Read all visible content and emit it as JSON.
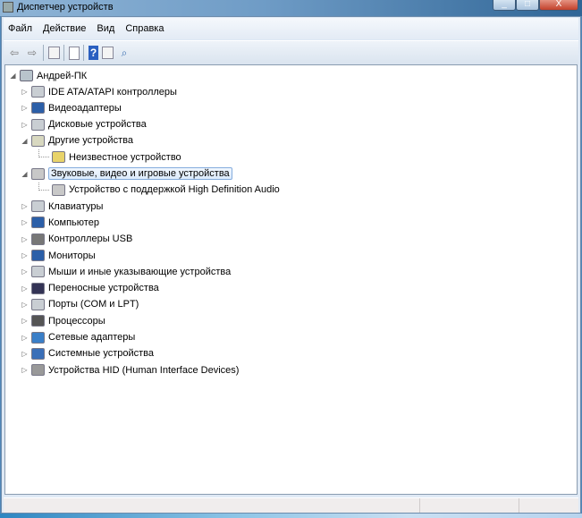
{
  "window": {
    "title": "Диспетчер устройств",
    "controls": [
      "_",
      "□",
      "X"
    ]
  },
  "menu": [
    "Файл",
    "Действие",
    "Вид",
    "Справка"
  ],
  "toolbar": [
    "back-icon",
    "forward-icon",
    "show-hide-tree-icon",
    "properties-icon",
    "help-icon",
    "action-pane-icon",
    "scan-hardware-icon"
  ],
  "tree": {
    "root": "Андрей-ПК",
    "items": [
      {
        "label": "IDE ATA/ATAPI контроллеры",
        "level": 1,
        "state": "collapsed",
        "icon": "ide-controller-icon"
      },
      {
        "label": "Видеоадаптеры",
        "level": 1,
        "state": "collapsed",
        "icon": "display-adapter-icon"
      },
      {
        "label": "Дисковые устройства",
        "level": 1,
        "state": "collapsed",
        "icon": "disk-drive-icon"
      },
      {
        "label": "Другие устройства",
        "level": 1,
        "state": "expanded",
        "icon": "other-devices-icon"
      },
      {
        "label": "Неизвестное устройство",
        "level": 2,
        "state": "leaf",
        "icon": "unknown-device-warning-icon"
      },
      {
        "label": "Звуковые, видео и игровые устройства",
        "level": 1,
        "state": "expanded",
        "icon": "speaker-icon",
        "selected": true
      },
      {
        "label": "Устройство с поддержкой High Definition Audio",
        "level": 2,
        "state": "leaf",
        "icon": "speaker-icon"
      },
      {
        "label": "Клавиатуры",
        "level": 1,
        "state": "collapsed",
        "icon": "keyboard-icon"
      },
      {
        "label": "Компьютер",
        "level": 1,
        "state": "collapsed",
        "icon": "computer-icon"
      },
      {
        "label": "Контроллеры USB",
        "level": 1,
        "state": "collapsed",
        "icon": "usb-icon"
      },
      {
        "label": "Мониторы",
        "level": 1,
        "state": "collapsed",
        "icon": "monitor-icon"
      },
      {
        "label": "Мыши и иные указывающие устройства",
        "level": 1,
        "state": "collapsed",
        "icon": "mouse-icon"
      },
      {
        "label": "Переносные устройства",
        "level": 1,
        "state": "collapsed",
        "icon": "portable-device-icon"
      },
      {
        "label": "Порты (COM и LPT)",
        "level": 1,
        "state": "collapsed",
        "icon": "port-icon"
      },
      {
        "label": "Процессоры",
        "level": 1,
        "state": "collapsed",
        "icon": "processor-icon"
      },
      {
        "label": "Сетевые адаптеры",
        "level": 1,
        "state": "collapsed",
        "icon": "network-adapter-icon"
      },
      {
        "label": "Системные устройства",
        "level": 1,
        "state": "collapsed",
        "icon": "system-devices-icon"
      },
      {
        "label": "Устройства HID (Human Interface Devices)",
        "level": 1,
        "state": "collapsed",
        "icon": "hid-icon"
      }
    ]
  }
}
